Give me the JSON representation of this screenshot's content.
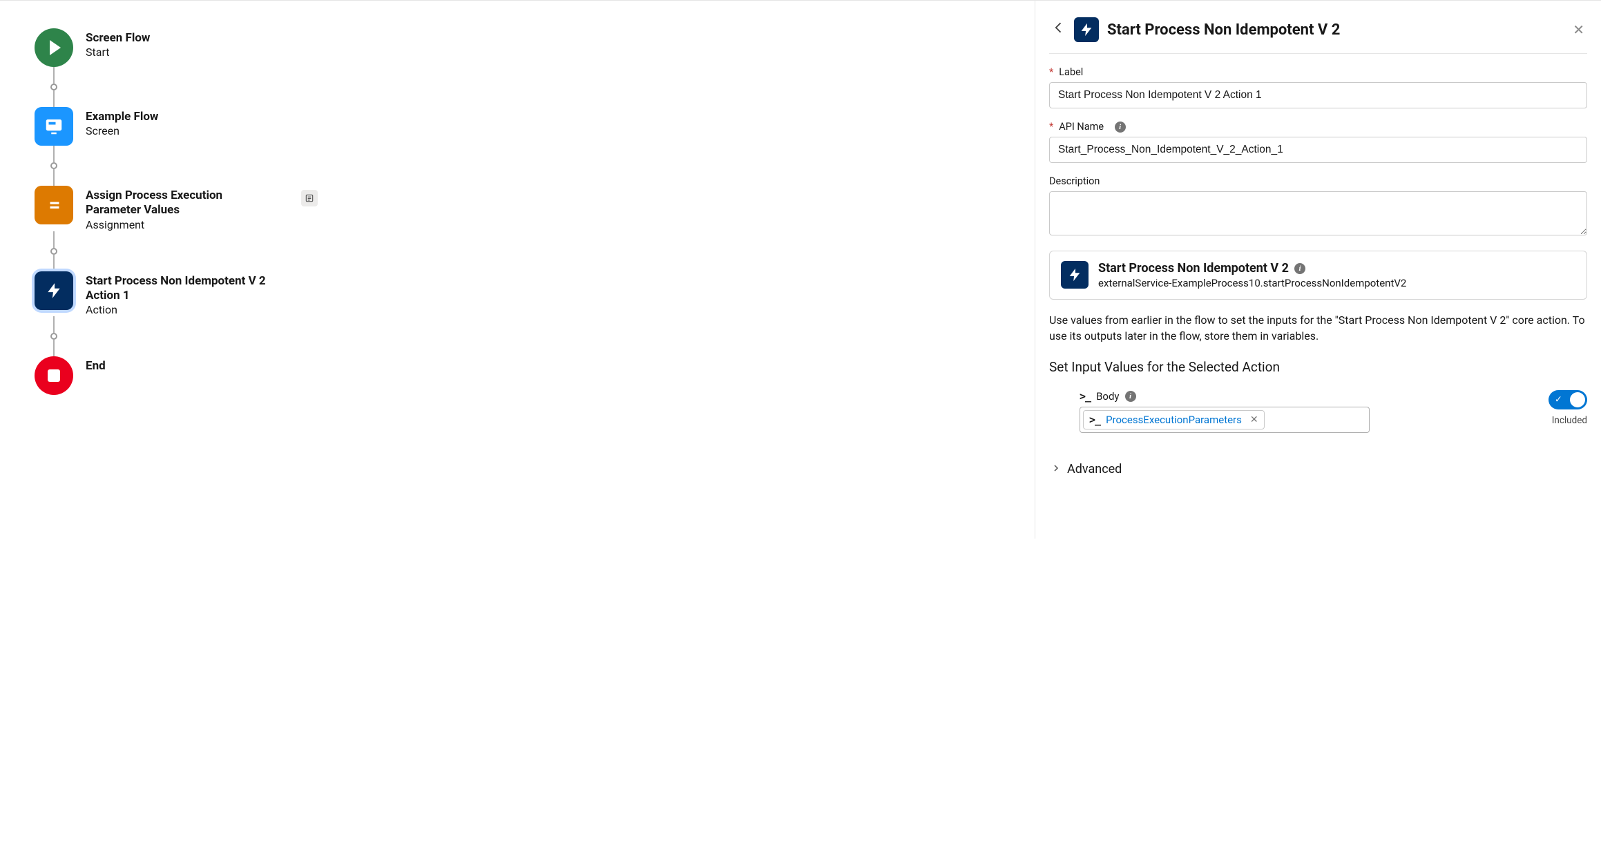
{
  "flow": {
    "nodes": [
      {
        "title": "Screen Flow",
        "sub": "Start"
      },
      {
        "title": "Example Flow",
        "sub": "Screen"
      },
      {
        "title": "Assign Process Execution Parameter Values",
        "sub": "Assignment"
      },
      {
        "title": "Start Process Non Idempotent V 2 Action 1",
        "sub": "Action"
      },
      {
        "title": "End",
        "sub": ""
      }
    ]
  },
  "panel": {
    "title": "Start Process Non Idempotent V 2",
    "label_field": "Label",
    "label_value": "Start Process Non Idempotent V 2 Action 1",
    "api_field": "API Name",
    "api_value": "Start_Process_Non_Idempotent_V_2_Action_1",
    "desc_field": "Description",
    "action_name": "Start Process Non Idempotent V 2",
    "action_path": "externalService-ExampleProcess10.startProcessNonIdempotentV2",
    "help_text": "Use values from earlier in the flow to set the inputs for the \"Start Process Non Idempotent V 2\" core action. To use its outputs later in the flow, store them in variables.",
    "section_head": "Set Input Values for the Selected Action",
    "body_label": "Body",
    "body_var": "ProcessExecutionParameters",
    "toggle_label": "Included",
    "advanced": "Advanced"
  }
}
